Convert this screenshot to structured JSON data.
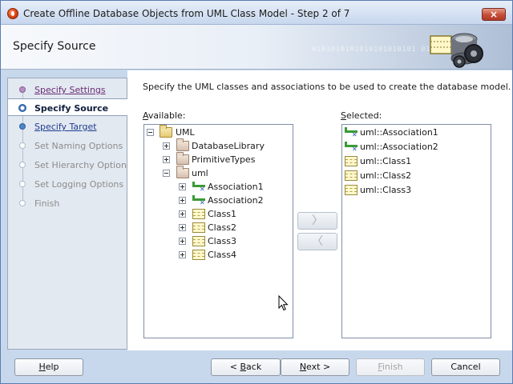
{
  "window": {
    "title": "Create Offline Database Objects from UML Class Model - Step 2 of 7",
    "close_icon": "×"
  },
  "header": {
    "title": "Specify Source",
    "binary_text": "0101010101010101010101 0101010101"
  },
  "steps": [
    {
      "label": "Specify Settings",
      "state": "visited"
    },
    {
      "label": "Specify Source",
      "state": "current"
    },
    {
      "label": "Specify Target",
      "state": "link"
    },
    {
      "label": "Set Naming Options",
      "state": "disabled"
    },
    {
      "label": "Set Hierarchy Options",
      "state": "disabled"
    },
    {
      "label": "Set Logging Options",
      "state": "disabled"
    },
    {
      "label": "Finish",
      "state": "disabled"
    }
  ],
  "main": {
    "instruction": "Specify the UML classes and associations to be used to create the database model.",
    "available_label_first": "A",
    "available_label_rest": "vailable:",
    "selected_label_first": "S",
    "selected_label_rest": "elected:",
    "available_tree": [
      {
        "label": "UML",
        "icon": "folder-icon",
        "expander": "minus"
      },
      {
        "label": "DatabaseLibrary",
        "icon": "package-icon",
        "expander": "plus"
      },
      {
        "label": "PrimitiveTypes",
        "icon": "package-icon",
        "expander": "plus"
      },
      {
        "label": "uml",
        "icon": "package-icon",
        "expander": "minus"
      },
      {
        "label": "Association1",
        "icon": "association-icon",
        "expander": "plus"
      },
      {
        "label": "Association2",
        "icon": "association-icon",
        "expander": "plus"
      },
      {
        "label": "Class1",
        "icon": "class-icon",
        "expander": "plus"
      },
      {
        "label": "Class2",
        "icon": "class-icon",
        "expander": "plus"
      },
      {
        "label": "Class3",
        "icon": "class-icon",
        "expander": "plus"
      },
      {
        "label": "Class4",
        "icon": "class-icon",
        "expander": "plus"
      }
    ],
    "selected_items": [
      {
        "label": "uml::Association1",
        "icon": "association-icon"
      },
      {
        "label": "uml::Association2",
        "icon": "association-icon"
      },
      {
        "label": "uml::Class1",
        "icon": "class-icon"
      },
      {
        "label": "uml::Class2",
        "icon": "class-icon"
      },
      {
        "label": "uml::Class3",
        "icon": "class-icon"
      }
    ],
    "move_right_glyph": "〉",
    "move_left_glyph": "〈"
  },
  "footer": {
    "help_first": "H",
    "help_rest": "elp",
    "back_pre": "< ",
    "back_first": "B",
    "back_rest": "ack",
    "next_first": "N",
    "next_rest": "ext >",
    "finish_first": "F",
    "finish_rest": "inish",
    "cancel": "Cancel"
  }
}
